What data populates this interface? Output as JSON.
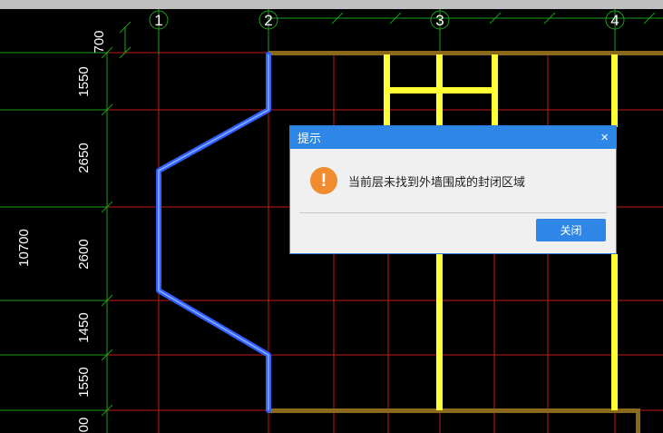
{
  "axes": [
    {
      "label": "1"
    },
    {
      "label": "2"
    },
    {
      "label": "3"
    },
    {
      "label": "4"
    }
  ],
  "dimensions": {
    "total": "10700",
    "segments": [
      "700",
      "1550",
      "2650",
      "2600",
      "1450",
      "1550",
      "00"
    ]
  },
  "dialog": {
    "title": "提示",
    "close_glyph": "×",
    "warning_glyph": "!",
    "message": "当前层未找到外墙围成的封闭区域",
    "close_button": "关闭"
  },
  "colors": {
    "grid_red": "#c41a1a",
    "dim_green": "#1ea01e",
    "wall_brown": "#8a6a1a",
    "wall_yellow": "#ffff33",
    "selected_blue": "#3060ff",
    "dialog_blue": "#2e87e6",
    "warning_orange": "#f08c2f"
  }
}
